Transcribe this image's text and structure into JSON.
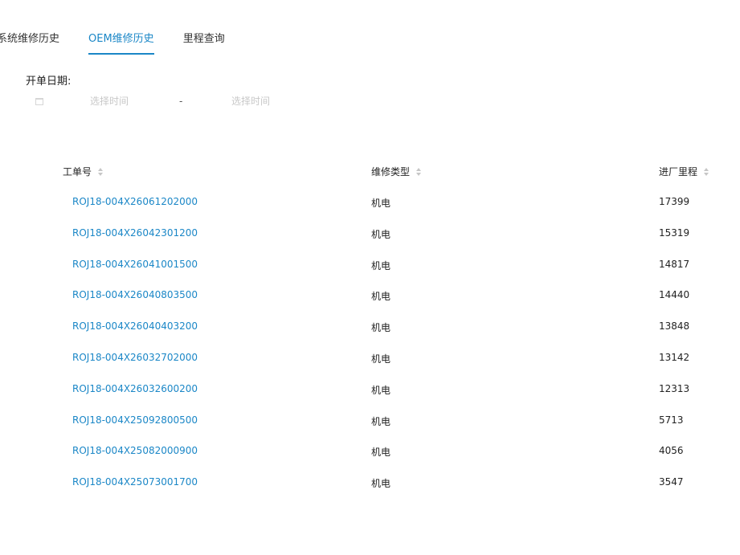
{
  "tabs": [
    {
      "label": "系统维修历史",
      "active": false
    },
    {
      "label": "OEM维修历史",
      "active": true
    },
    {
      "label": "里程查询",
      "active": false
    }
  ],
  "filter": {
    "label": "开单日期:",
    "start_placeholder": "选择时间",
    "separator": "-",
    "end_placeholder": "选择时间",
    "icon": "calendar-icon"
  },
  "table": {
    "columns": [
      "工单号",
      "维修类型",
      "进厂里程"
    ],
    "sort_icon": "sort-icon",
    "rows": [
      {
        "order_no": "ROJ18-004X26061202000",
        "type": "机电",
        "mileage": "17399"
      },
      {
        "order_no": "ROJ18-004X26042301200",
        "type": "机电",
        "mileage": "15319"
      },
      {
        "order_no": "ROJ18-004X26041001500",
        "type": "机电",
        "mileage": "14817"
      },
      {
        "order_no": "ROJ18-004X26040803500",
        "type": "机电",
        "mileage": "14440"
      },
      {
        "order_no": "ROJ18-004X26040403200",
        "type": "机电",
        "mileage": "13848"
      },
      {
        "order_no": "ROJ18-004X26032702000",
        "type": "机电",
        "mileage": "13142"
      },
      {
        "order_no": "ROJ18-004X26032600200",
        "type": "机电",
        "mileage": "12313"
      },
      {
        "order_no": "ROJ18-004X25092800500",
        "type": "机电",
        "mileage": "5713"
      },
      {
        "order_no": "ROJ18-004X25082000900",
        "type": "机电",
        "mileage": "4056"
      },
      {
        "order_no": "ROJ18-004X25073001700",
        "type": "机电",
        "mileage": "3547"
      }
    ]
  },
  "colors": {
    "accent": "#1b87c7",
    "text": "#222222",
    "placeholder": "#c8c8c8"
  }
}
